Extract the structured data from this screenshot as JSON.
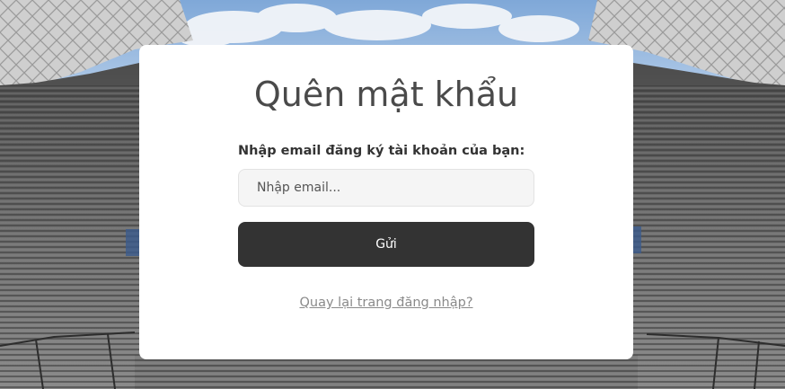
{
  "page": {
    "title": "Quên mật khẩu",
    "email_label": "Nhập email đăng ký tài khoản của bạn:",
    "email_placeholder": "Nhập email...",
    "email_value": "",
    "submit_label": "Gửi",
    "back_link": "Quay lại trang đăng nhập?"
  },
  "colors": {
    "card_bg": "#ffffff",
    "button_bg": "#333333",
    "button_text": "#ffffff",
    "title_text": "#4a4a4a",
    "link_text": "#8a8a8a",
    "input_bg": "#f5f5f5"
  },
  "background": {
    "image": "stadium-photo"
  }
}
